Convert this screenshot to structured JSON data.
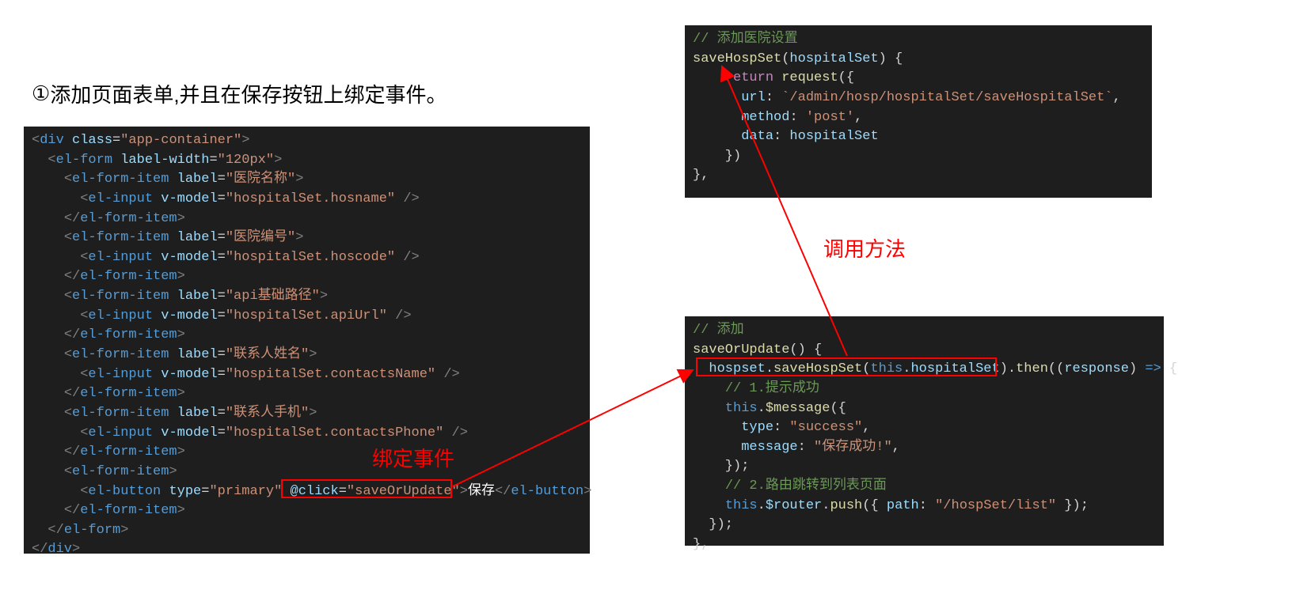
{
  "heading": {
    "marker": "①",
    "text": "添加页面表单,并且在保存按钮上绑定事件。"
  },
  "annotations": {
    "bind_event": "绑定事件",
    "call_method": "调用方法"
  },
  "code_left": {
    "lines": [
      [
        {
          "t": "<",
          "c": "c-punc"
        },
        {
          "t": "div",
          "c": "c-tag"
        },
        {
          "t": " "
        },
        {
          "t": "class",
          "c": "c-attr"
        },
        {
          "t": "=",
          "c": "c-plain"
        },
        {
          "t": "\"app-container\"",
          "c": "c-str"
        },
        {
          "t": ">",
          "c": "c-punc"
        }
      ],
      [
        {
          "t": "  "
        },
        {
          "t": "<",
          "c": "c-punc"
        },
        {
          "t": "el-form",
          "c": "c-tag"
        },
        {
          "t": " "
        },
        {
          "t": "label-width",
          "c": "c-attr"
        },
        {
          "t": "=",
          "c": "c-plain"
        },
        {
          "t": "\"120px\"",
          "c": "c-str"
        },
        {
          "t": ">",
          "c": "c-punc"
        }
      ],
      [
        {
          "t": "    "
        },
        {
          "t": "<",
          "c": "c-punc"
        },
        {
          "t": "el-form-item",
          "c": "c-tag"
        },
        {
          "t": " "
        },
        {
          "t": "label",
          "c": "c-attr"
        },
        {
          "t": "=",
          "c": "c-plain"
        },
        {
          "t": "\"医院名称\"",
          "c": "c-str"
        },
        {
          "t": ">",
          "c": "c-punc"
        }
      ],
      [
        {
          "t": "      "
        },
        {
          "t": "<",
          "c": "c-punc"
        },
        {
          "t": "el-input",
          "c": "c-tag"
        },
        {
          "t": " "
        },
        {
          "t": "v-model",
          "c": "c-attr"
        },
        {
          "t": "=",
          "c": "c-plain"
        },
        {
          "t": "\"hospitalSet.hosname\"",
          "c": "c-str"
        },
        {
          "t": " />",
          "c": "c-punc"
        }
      ],
      [
        {
          "t": "    "
        },
        {
          "t": "</",
          "c": "c-punc"
        },
        {
          "t": "el-form-item",
          "c": "c-tag"
        },
        {
          "t": ">",
          "c": "c-punc"
        }
      ],
      [
        {
          "t": "    "
        },
        {
          "t": "<",
          "c": "c-punc"
        },
        {
          "t": "el-form-item",
          "c": "c-tag"
        },
        {
          "t": " "
        },
        {
          "t": "label",
          "c": "c-attr"
        },
        {
          "t": "=",
          "c": "c-plain"
        },
        {
          "t": "\"医院编号\"",
          "c": "c-str"
        },
        {
          "t": ">",
          "c": "c-punc"
        }
      ],
      [
        {
          "t": "      "
        },
        {
          "t": "<",
          "c": "c-punc"
        },
        {
          "t": "el-input",
          "c": "c-tag"
        },
        {
          "t": " "
        },
        {
          "t": "v-model",
          "c": "c-attr"
        },
        {
          "t": "=",
          "c": "c-plain"
        },
        {
          "t": "\"hospitalSet.hoscode\"",
          "c": "c-str"
        },
        {
          "t": " />",
          "c": "c-punc"
        }
      ],
      [
        {
          "t": "    "
        },
        {
          "t": "</",
          "c": "c-punc"
        },
        {
          "t": "el-form-item",
          "c": "c-tag"
        },
        {
          "t": ">",
          "c": "c-punc"
        }
      ],
      [
        {
          "t": "    "
        },
        {
          "t": "<",
          "c": "c-punc"
        },
        {
          "t": "el-form-item",
          "c": "c-tag"
        },
        {
          "t": " "
        },
        {
          "t": "label",
          "c": "c-attr"
        },
        {
          "t": "=",
          "c": "c-plain"
        },
        {
          "t": "\"api基础路径\"",
          "c": "c-str"
        },
        {
          "t": ">",
          "c": "c-punc"
        }
      ],
      [
        {
          "t": "      "
        },
        {
          "t": "<",
          "c": "c-punc"
        },
        {
          "t": "el-input",
          "c": "c-tag"
        },
        {
          "t": " "
        },
        {
          "t": "v-model",
          "c": "c-attr"
        },
        {
          "t": "=",
          "c": "c-plain"
        },
        {
          "t": "\"hospitalSet.apiUrl\"",
          "c": "c-str"
        },
        {
          "t": " />",
          "c": "c-punc"
        }
      ],
      [
        {
          "t": "    "
        },
        {
          "t": "</",
          "c": "c-punc"
        },
        {
          "t": "el-form-item",
          "c": "c-tag"
        },
        {
          "t": ">",
          "c": "c-punc"
        }
      ],
      [
        {
          "t": "    "
        },
        {
          "t": "<",
          "c": "c-punc"
        },
        {
          "t": "el-form-item",
          "c": "c-tag"
        },
        {
          "t": " "
        },
        {
          "t": "label",
          "c": "c-attr"
        },
        {
          "t": "=",
          "c": "c-plain"
        },
        {
          "t": "\"联系人姓名\"",
          "c": "c-str"
        },
        {
          "t": ">",
          "c": "c-punc"
        }
      ],
      [
        {
          "t": "      "
        },
        {
          "t": "<",
          "c": "c-punc"
        },
        {
          "t": "el-input",
          "c": "c-tag"
        },
        {
          "t": " "
        },
        {
          "t": "v-model",
          "c": "c-attr"
        },
        {
          "t": "=",
          "c": "c-plain"
        },
        {
          "t": "\"hospitalSet.contactsName\"",
          "c": "c-str"
        },
        {
          "t": " />",
          "c": "c-punc"
        }
      ],
      [
        {
          "t": "    "
        },
        {
          "t": "</",
          "c": "c-punc"
        },
        {
          "t": "el-form-item",
          "c": "c-tag"
        },
        {
          "t": ">",
          "c": "c-punc"
        }
      ],
      [
        {
          "t": "    "
        },
        {
          "t": "<",
          "c": "c-punc"
        },
        {
          "t": "el-form-item",
          "c": "c-tag"
        },
        {
          "t": " "
        },
        {
          "t": "label",
          "c": "c-attr"
        },
        {
          "t": "=",
          "c": "c-plain"
        },
        {
          "t": "\"联系人手机\"",
          "c": "c-str"
        },
        {
          "t": ">",
          "c": "c-punc"
        }
      ],
      [
        {
          "t": "      "
        },
        {
          "t": "<",
          "c": "c-punc"
        },
        {
          "t": "el-input",
          "c": "c-tag"
        },
        {
          "t": " "
        },
        {
          "t": "v-model",
          "c": "c-attr"
        },
        {
          "t": "=",
          "c": "c-plain"
        },
        {
          "t": "\"hospitalSet.contactsPhone\"",
          "c": "c-str"
        },
        {
          "t": " />",
          "c": "c-punc"
        }
      ],
      [
        {
          "t": "    "
        },
        {
          "t": "</",
          "c": "c-punc"
        },
        {
          "t": "el-form-item",
          "c": "c-tag"
        },
        {
          "t": ">",
          "c": "c-punc"
        }
      ],
      [
        {
          "t": "    "
        },
        {
          "t": "<",
          "c": "c-punc"
        },
        {
          "t": "el-form-item",
          "c": "c-tag"
        },
        {
          "t": ">",
          "c": "c-punc"
        }
      ],
      [
        {
          "t": "      "
        },
        {
          "t": "<",
          "c": "c-punc"
        },
        {
          "t": "el-button",
          "c": "c-tag"
        },
        {
          "t": " "
        },
        {
          "t": "type",
          "c": "c-attr"
        },
        {
          "t": "=",
          "c": "c-plain"
        },
        {
          "t": "\"primary\"",
          "c": "c-str"
        },
        {
          "t": " "
        },
        {
          "t": "@click",
          "c": "c-attr"
        },
        {
          "t": "=",
          "c": "c-plain"
        },
        {
          "t": "\"saveOrUpdate\"",
          "c": "c-str"
        },
        {
          "t": ">",
          "c": "c-punc"
        },
        {
          "t": "保存",
          "c": "c-white"
        },
        {
          "t": "</",
          "c": "c-punc"
        },
        {
          "t": "el-button",
          "c": "c-tag"
        },
        {
          "t": ">",
          "c": "c-punc"
        }
      ],
      [
        {
          "t": "    "
        },
        {
          "t": "</",
          "c": "c-punc"
        },
        {
          "t": "el-form-item",
          "c": "c-tag"
        },
        {
          "t": ">",
          "c": "c-punc"
        }
      ],
      [
        {
          "t": "  "
        },
        {
          "t": "</",
          "c": "c-punc"
        },
        {
          "t": "el-form",
          "c": "c-tag"
        },
        {
          "t": ">",
          "c": "c-punc"
        }
      ],
      [
        {
          "t": "</",
          "c": "c-punc"
        },
        {
          "t": "div",
          "c": "c-tag"
        },
        {
          "t": ">",
          "c": "c-punc"
        }
      ]
    ]
  },
  "code_top_right": {
    "lines": [
      [
        {
          "t": "// 添加医院设置",
          "c": "c-comment"
        }
      ],
      [
        {
          "t": "saveHospSet",
          "c": "c-func"
        },
        {
          "t": "(",
          "c": "c-plain"
        },
        {
          "t": "hospitalSet",
          "c": "c-var"
        },
        {
          "t": ") {",
          "c": "c-plain"
        }
      ],
      [
        {
          "t": "    "
        },
        {
          "t": "return",
          "c": "c-key"
        },
        {
          "t": " ",
          "c": "c-plain"
        },
        {
          "t": "request",
          "c": "c-func"
        },
        {
          "t": "({",
          "c": "c-plain"
        }
      ],
      [
        {
          "t": "      "
        },
        {
          "t": "url",
          "c": "c-prop"
        },
        {
          "t": ":",
          "c": "c-plain"
        },
        {
          "t": " `/admin/hosp/hospitalSet/saveHospitalSet`",
          "c": "c-str"
        },
        {
          "t": ",",
          "c": "c-plain"
        }
      ],
      [
        {
          "t": "      "
        },
        {
          "t": "method",
          "c": "c-prop"
        },
        {
          "t": ":",
          "c": "c-plain"
        },
        {
          "t": " 'post'",
          "c": "c-str"
        },
        {
          "t": ",",
          "c": "c-plain"
        }
      ],
      [
        {
          "t": "      "
        },
        {
          "t": "data",
          "c": "c-prop"
        },
        {
          "t": ":",
          "c": "c-plain"
        },
        {
          "t": " hospitalSet",
          "c": "c-var"
        }
      ],
      [
        {
          "t": "    })",
          "c": "c-plain"
        }
      ],
      [
        {
          "t": "},",
          "c": "c-plain"
        }
      ]
    ]
  },
  "code_bot_right": {
    "lines": [
      [
        {
          "t": "// 添加",
          "c": "c-comment"
        }
      ],
      [
        {
          "t": "saveOrUpdate",
          "c": "c-func"
        },
        {
          "t": "() {",
          "c": "c-plain"
        }
      ],
      [
        {
          "t": "  "
        },
        {
          "t": "hospset",
          "c": "c-var"
        },
        {
          "t": ".",
          "c": "c-plain"
        },
        {
          "t": "saveHospSet",
          "c": "c-func"
        },
        {
          "t": "(",
          "c": "c-plain"
        },
        {
          "t": "this",
          "c": "c-this"
        },
        {
          "t": ".",
          "c": "c-plain"
        },
        {
          "t": "hospitalSet",
          "c": "c-var"
        },
        {
          "t": ").",
          "c": "c-plain"
        },
        {
          "t": "then",
          "c": "c-func"
        },
        {
          "t": "((",
          "c": "c-plain"
        },
        {
          "t": "response",
          "c": "c-var"
        },
        {
          "t": ") ",
          "c": "c-plain"
        },
        {
          "t": "=>",
          "c": "c-kw"
        },
        {
          "t": " {",
          "c": "c-plain"
        }
      ],
      [
        {
          "t": "    "
        },
        {
          "t": "// 1.提示成功",
          "c": "c-comment"
        }
      ],
      [
        {
          "t": "    "
        },
        {
          "t": "this",
          "c": "c-this"
        },
        {
          "t": ".",
          "c": "c-plain"
        },
        {
          "t": "$message",
          "c": "c-func"
        },
        {
          "t": "({",
          "c": "c-plain"
        }
      ],
      [
        {
          "t": "      "
        },
        {
          "t": "type",
          "c": "c-prop"
        },
        {
          "t": ":",
          "c": "c-plain"
        },
        {
          "t": " \"success\"",
          "c": "c-str"
        },
        {
          "t": ",",
          "c": "c-plain"
        }
      ],
      [
        {
          "t": "      "
        },
        {
          "t": "message",
          "c": "c-prop"
        },
        {
          "t": ":",
          "c": "c-plain"
        },
        {
          "t": " \"保存成功!\"",
          "c": "c-str"
        },
        {
          "t": ",",
          "c": "c-plain"
        }
      ],
      [
        {
          "t": "    });",
          "c": "c-plain"
        }
      ],
      [
        {
          "t": "    "
        },
        {
          "t": "// 2.路由跳转到列表页面",
          "c": "c-comment"
        }
      ],
      [
        {
          "t": "    "
        },
        {
          "t": "this",
          "c": "c-this"
        },
        {
          "t": ".",
          "c": "c-plain"
        },
        {
          "t": "$router",
          "c": "c-var"
        },
        {
          "t": ".",
          "c": "c-plain"
        },
        {
          "t": "push",
          "c": "c-func"
        },
        {
          "t": "({ ",
          "c": "c-plain"
        },
        {
          "t": "path",
          "c": "c-prop"
        },
        {
          "t": ":",
          "c": "c-plain"
        },
        {
          "t": " \"/hospSet/list\"",
          "c": "c-str"
        },
        {
          "t": " });",
          "c": "c-plain"
        }
      ],
      [
        {
          "t": "  });",
          "c": "c-plain"
        }
      ],
      [
        {
          "t": "},",
          "c": "c-plain"
        }
      ]
    ]
  }
}
